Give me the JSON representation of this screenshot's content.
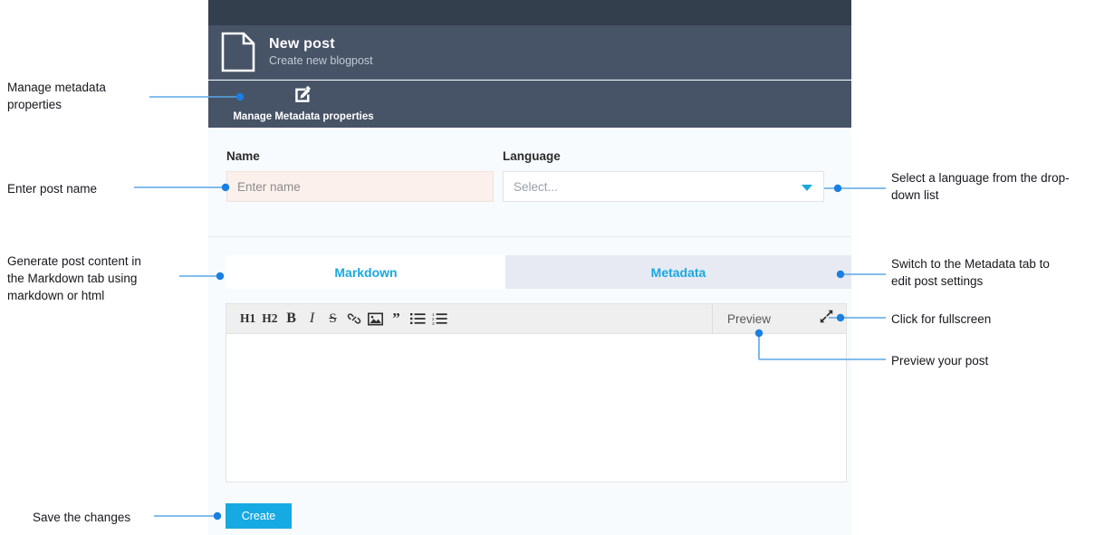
{
  "app": {
    "header": {
      "title": "New post",
      "subtitle": "Create new blogpost",
      "icon": "document-icon"
    },
    "toolbar": {
      "metadata_button": {
        "label": "Manage Metadata properties",
        "icon": "edit-pencil-icon"
      }
    },
    "form": {
      "name_field": {
        "label": "Name",
        "value": "",
        "placeholder": "Enter name"
      },
      "language_field": {
        "label": "Language",
        "value": "",
        "placeholder": "Select...",
        "caret_icon": "chevron-down-icon"
      }
    },
    "tabs": [
      {
        "label": "Markdown",
        "active": true
      },
      {
        "label": "Metadata",
        "active": false
      }
    ],
    "editor": {
      "tools": [
        {
          "name": "heading-1",
          "glyph": "H1",
          "style": "h"
        },
        {
          "name": "heading-2",
          "glyph": "H2",
          "style": "h"
        },
        {
          "name": "bold",
          "glyph": "B",
          "style": "b"
        },
        {
          "name": "italic",
          "glyph": "I",
          "style": "i"
        },
        {
          "name": "strikethrough",
          "glyph": "S",
          "style": "s"
        },
        {
          "name": "link",
          "glyph": "",
          "style": "svg-link"
        },
        {
          "name": "image",
          "glyph": "",
          "style": "svg-image"
        },
        {
          "name": "quote",
          "glyph": "”",
          "style": "q"
        },
        {
          "name": "unordered-list",
          "glyph": "",
          "style": "svg-ul"
        },
        {
          "name": "ordered-list",
          "glyph": "",
          "style": "svg-ol"
        }
      ],
      "preview_label": "Preview",
      "fullscreen_icon": "expand-arrows-icon",
      "content": ""
    },
    "footer": {
      "create_label": "Create"
    }
  },
  "annotations": {
    "manage_metadata": "Manage metadata\nproperties",
    "enter_post_name": "Enter post name",
    "generate_content": "Generate post content in\nthe Markdown tab using\nmarkdown or html",
    "save_changes": "Save the changes",
    "select_language": "Select a language from the drop-\ndown list",
    "switch_metadata": "Switch to the Metadata tab to\nedit post settings",
    "click_fullscreen": "Click for fullscreen",
    "preview_post": "Preview your post"
  },
  "colors": {
    "topbar": "#333f4d",
    "header": "#475366",
    "accent": "#19a8e0",
    "button": "#17a9e2",
    "annotation_line": "#5aa7e8",
    "annotation_dot": "#1a7fe0",
    "tab_inactive": "#e7eaf2",
    "input_error_bg": "#fbf0ec",
    "panel_bg": "#f7fbfd"
  }
}
